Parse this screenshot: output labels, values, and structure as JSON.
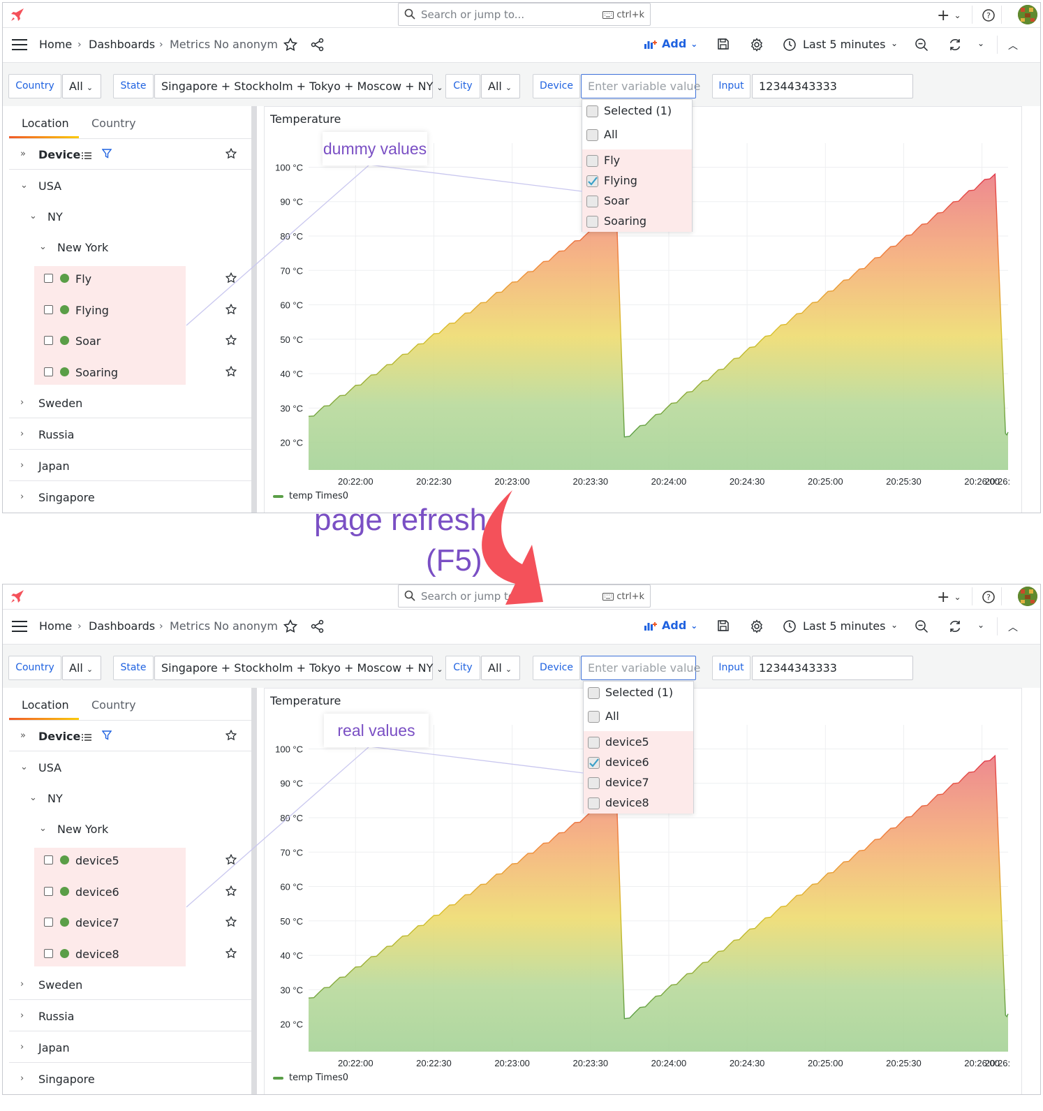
{
  "topbar": {
    "search_placeholder": "Search or jump to...",
    "shortcut": "ctrl+k",
    "plus_label": "+"
  },
  "nav": {
    "home": "Home",
    "dashboards": "Dashboards",
    "dashboard_title": "Metrics No anonym",
    "add_label": "Add",
    "time_range": "Last 5 minutes"
  },
  "variables": {
    "country_label": "Country",
    "country_value": "All",
    "state_label": "State",
    "state_value": "Singapore + Stockholm + Tokyo + Moscow + NY",
    "city_label": "City",
    "city_value": "All",
    "device_label": "Device",
    "device_placeholder": "Enter variable value",
    "input_label": "Input",
    "input_value": "12344343333"
  },
  "tree": {
    "tab_location": "Location",
    "tab_country": "Country",
    "header": "Device",
    "usa": "USA",
    "ny": "NY",
    "new_york": "New York",
    "others": [
      "Sweden",
      "Russia",
      "Japan",
      "Singapore"
    ]
  },
  "dropdown": {
    "selected": "Selected (1)",
    "all": "All"
  },
  "before": {
    "devices": [
      "Fly",
      "Flying",
      "Soar",
      "Soaring"
    ],
    "checked_index": 1,
    "callout": "dummy values"
  },
  "after": {
    "devices": [
      "device5",
      "device6",
      "device7",
      "device8"
    ],
    "checked_index": 1,
    "callout": "real values"
  },
  "annotation": {
    "line1": "page refresh",
    "line2": "(F5)"
  },
  "colors": {
    "accent": "#1f62e0",
    "callout_text": "#7a4fc4",
    "arrow": "#f4515a",
    "series": "#5a9e47",
    "highlight": "#fdeaea"
  },
  "chart_data": {
    "type": "area",
    "title": "Temperature",
    "ylabel": "",
    "y_ticks": [
      "100 °C",
      "90 °C",
      "80 °C",
      "70 °C",
      "60 °C",
      "50 °C",
      "40 °C",
      "30 °C",
      "20 °C"
    ],
    "x_ticks": [
      "20:22:00",
      "20:22:30",
      "20:23:00",
      "20:23:30",
      "20:24:00",
      "20:24:30",
      "20:25:00",
      "20:25:30",
      "20:26:00",
      "20:26:"
    ],
    "ylim": [
      12,
      107
    ],
    "series": [
      {
        "name": "temp Times0",
        "x": [
          "20:21:42",
          "20:23:40",
          "20:23:43",
          "20:26:05",
          "20:26:09",
          "20:26:10"
        ],
        "values": [
          27,
          86,
          21,
          98,
          22,
          23
        ]
      }
    ]
  }
}
